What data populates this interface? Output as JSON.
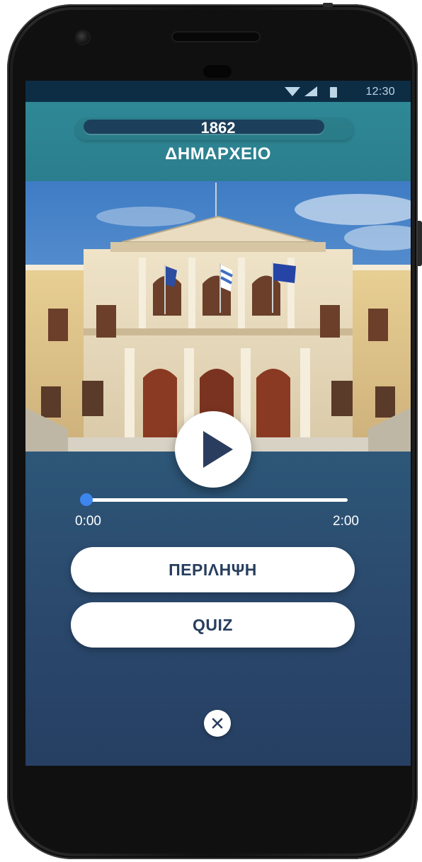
{
  "status_bar": {
    "time": "12:30",
    "icons": [
      "wifi-icon",
      "signal-icon",
      "battery-icon"
    ]
  },
  "header": {
    "year": "1862",
    "title": "ΔΗΜΑΡΧΕΙΟ"
  },
  "player": {
    "progress": 0,
    "time_start": "0:00",
    "time_end": "2:00",
    "play_icon": "play-icon"
  },
  "actions": {
    "summary_label": "ΠΕΡΙΛΗΨΗ",
    "quiz_label": "QUIZ",
    "close_icon": "close-icon"
  },
  "colors": {
    "header": "#2f8896",
    "status_bar": "#0d2d45",
    "button_text": "#273e5e",
    "progress_knob": "#3d86f0"
  }
}
